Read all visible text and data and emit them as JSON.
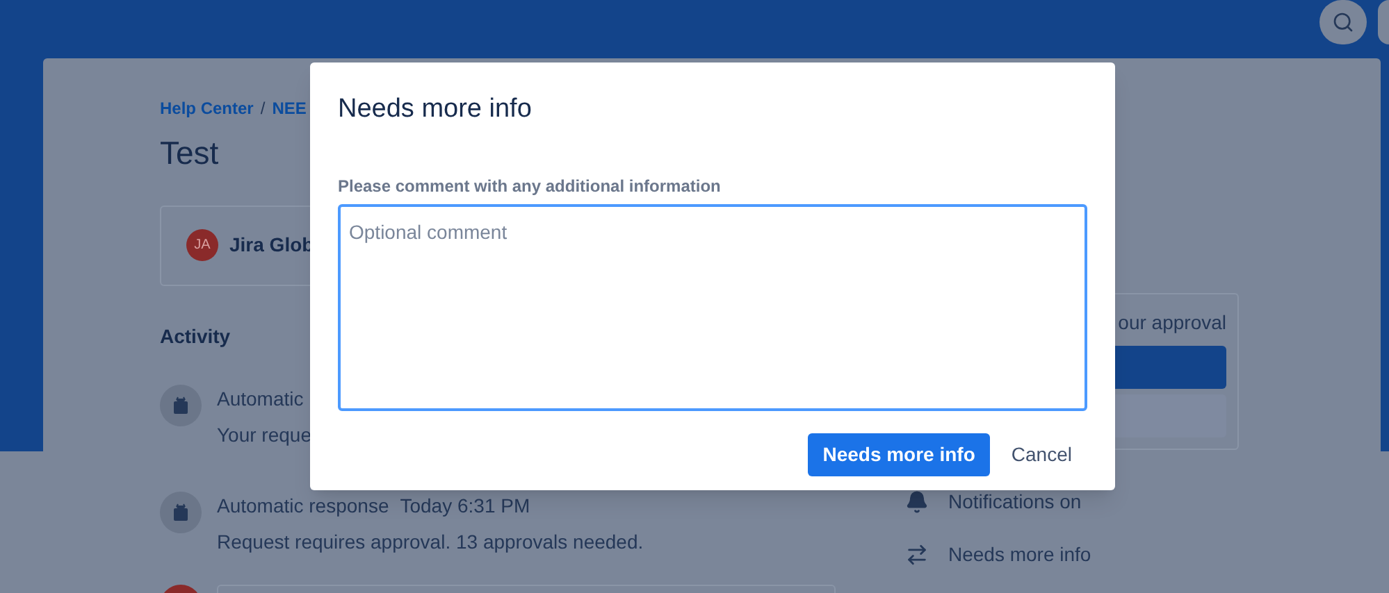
{
  "breadcrumb": [
    "Help Center",
    "NEE"
  ],
  "breadcrumb_separator": "/",
  "title": "Test",
  "reporter": {
    "initials": "JA",
    "name": "Jira Glob"
  },
  "activity": {
    "heading": "Activity",
    "items": [
      {
        "author": "Automatic",
        "text": "Your reque"
      },
      {
        "author": "Automatic response",
        "time": "Today 6:31 PM",
        "text": "Request requires approval. 13 approvals needed."
      }
    ]
  },
  "approval": {
    "text": "our approval"
  },
  "sidebar_actions": [
    {
      "kind": "bell",
      "label": "Notifications on"
    },
    {
      "kind": "transition",
      "label": "Needs more info"
    }
  ],
  "dialog": {
    "title": "Needs more info",
    "field_label": "Please comment with any additional information",
    "placeholder": "Optional comment",
    "primary": "Needs more info",
    "cancel": "Cancel"
  }
}
